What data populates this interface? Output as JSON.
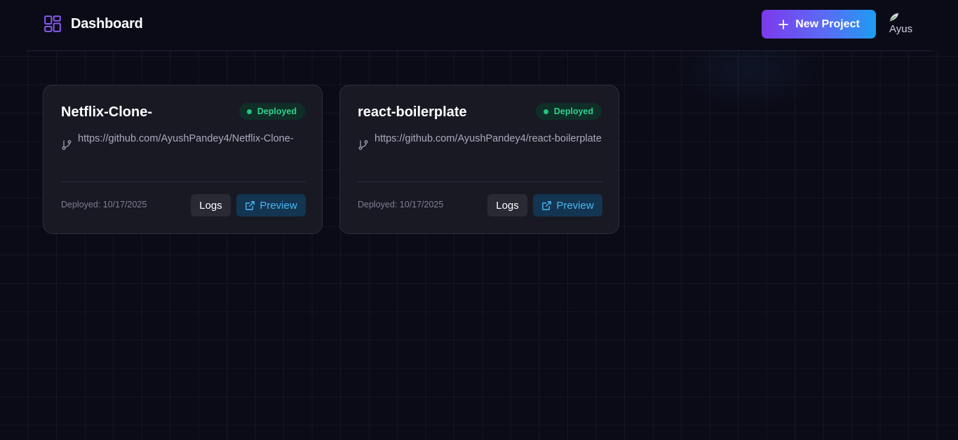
{
  "header": {
    "title": "Dashboard",
    "brand_icon": "dashboard-grid-icon",
    "new_project_label": "New Project",
    "avatar_alt": "Ayush"
  },
  "colors": {
    "accent_gradient": [
      "#7c3aed",
      "#1e9cf2"
    ],
    "status_deployed": "#2fd08e",
    "preview": "#4cb6f2"
  },
  "projects": [
    {
      "name": "Netflix-Clone-",
      "status": "Deployed",
      "repo_url": "https://github.com/AyushPandey4/Netflix-Clone-",
      "deployed_text": "Deployed: 10/17/2025",
      "logs_label": "Logs",
      "preview_label": "Preview"
    },
    {
      "name": "react-boilerplate",
      "status": "Deployed",
      "repo_url": "https://github.com/AyushPandey4/react-boilerplate",
      "deployed_text": "Deployed: 10/17/2025",
      "logs_label": "Logs",
      "preview_label": "Preview"
    }
  ]
}
